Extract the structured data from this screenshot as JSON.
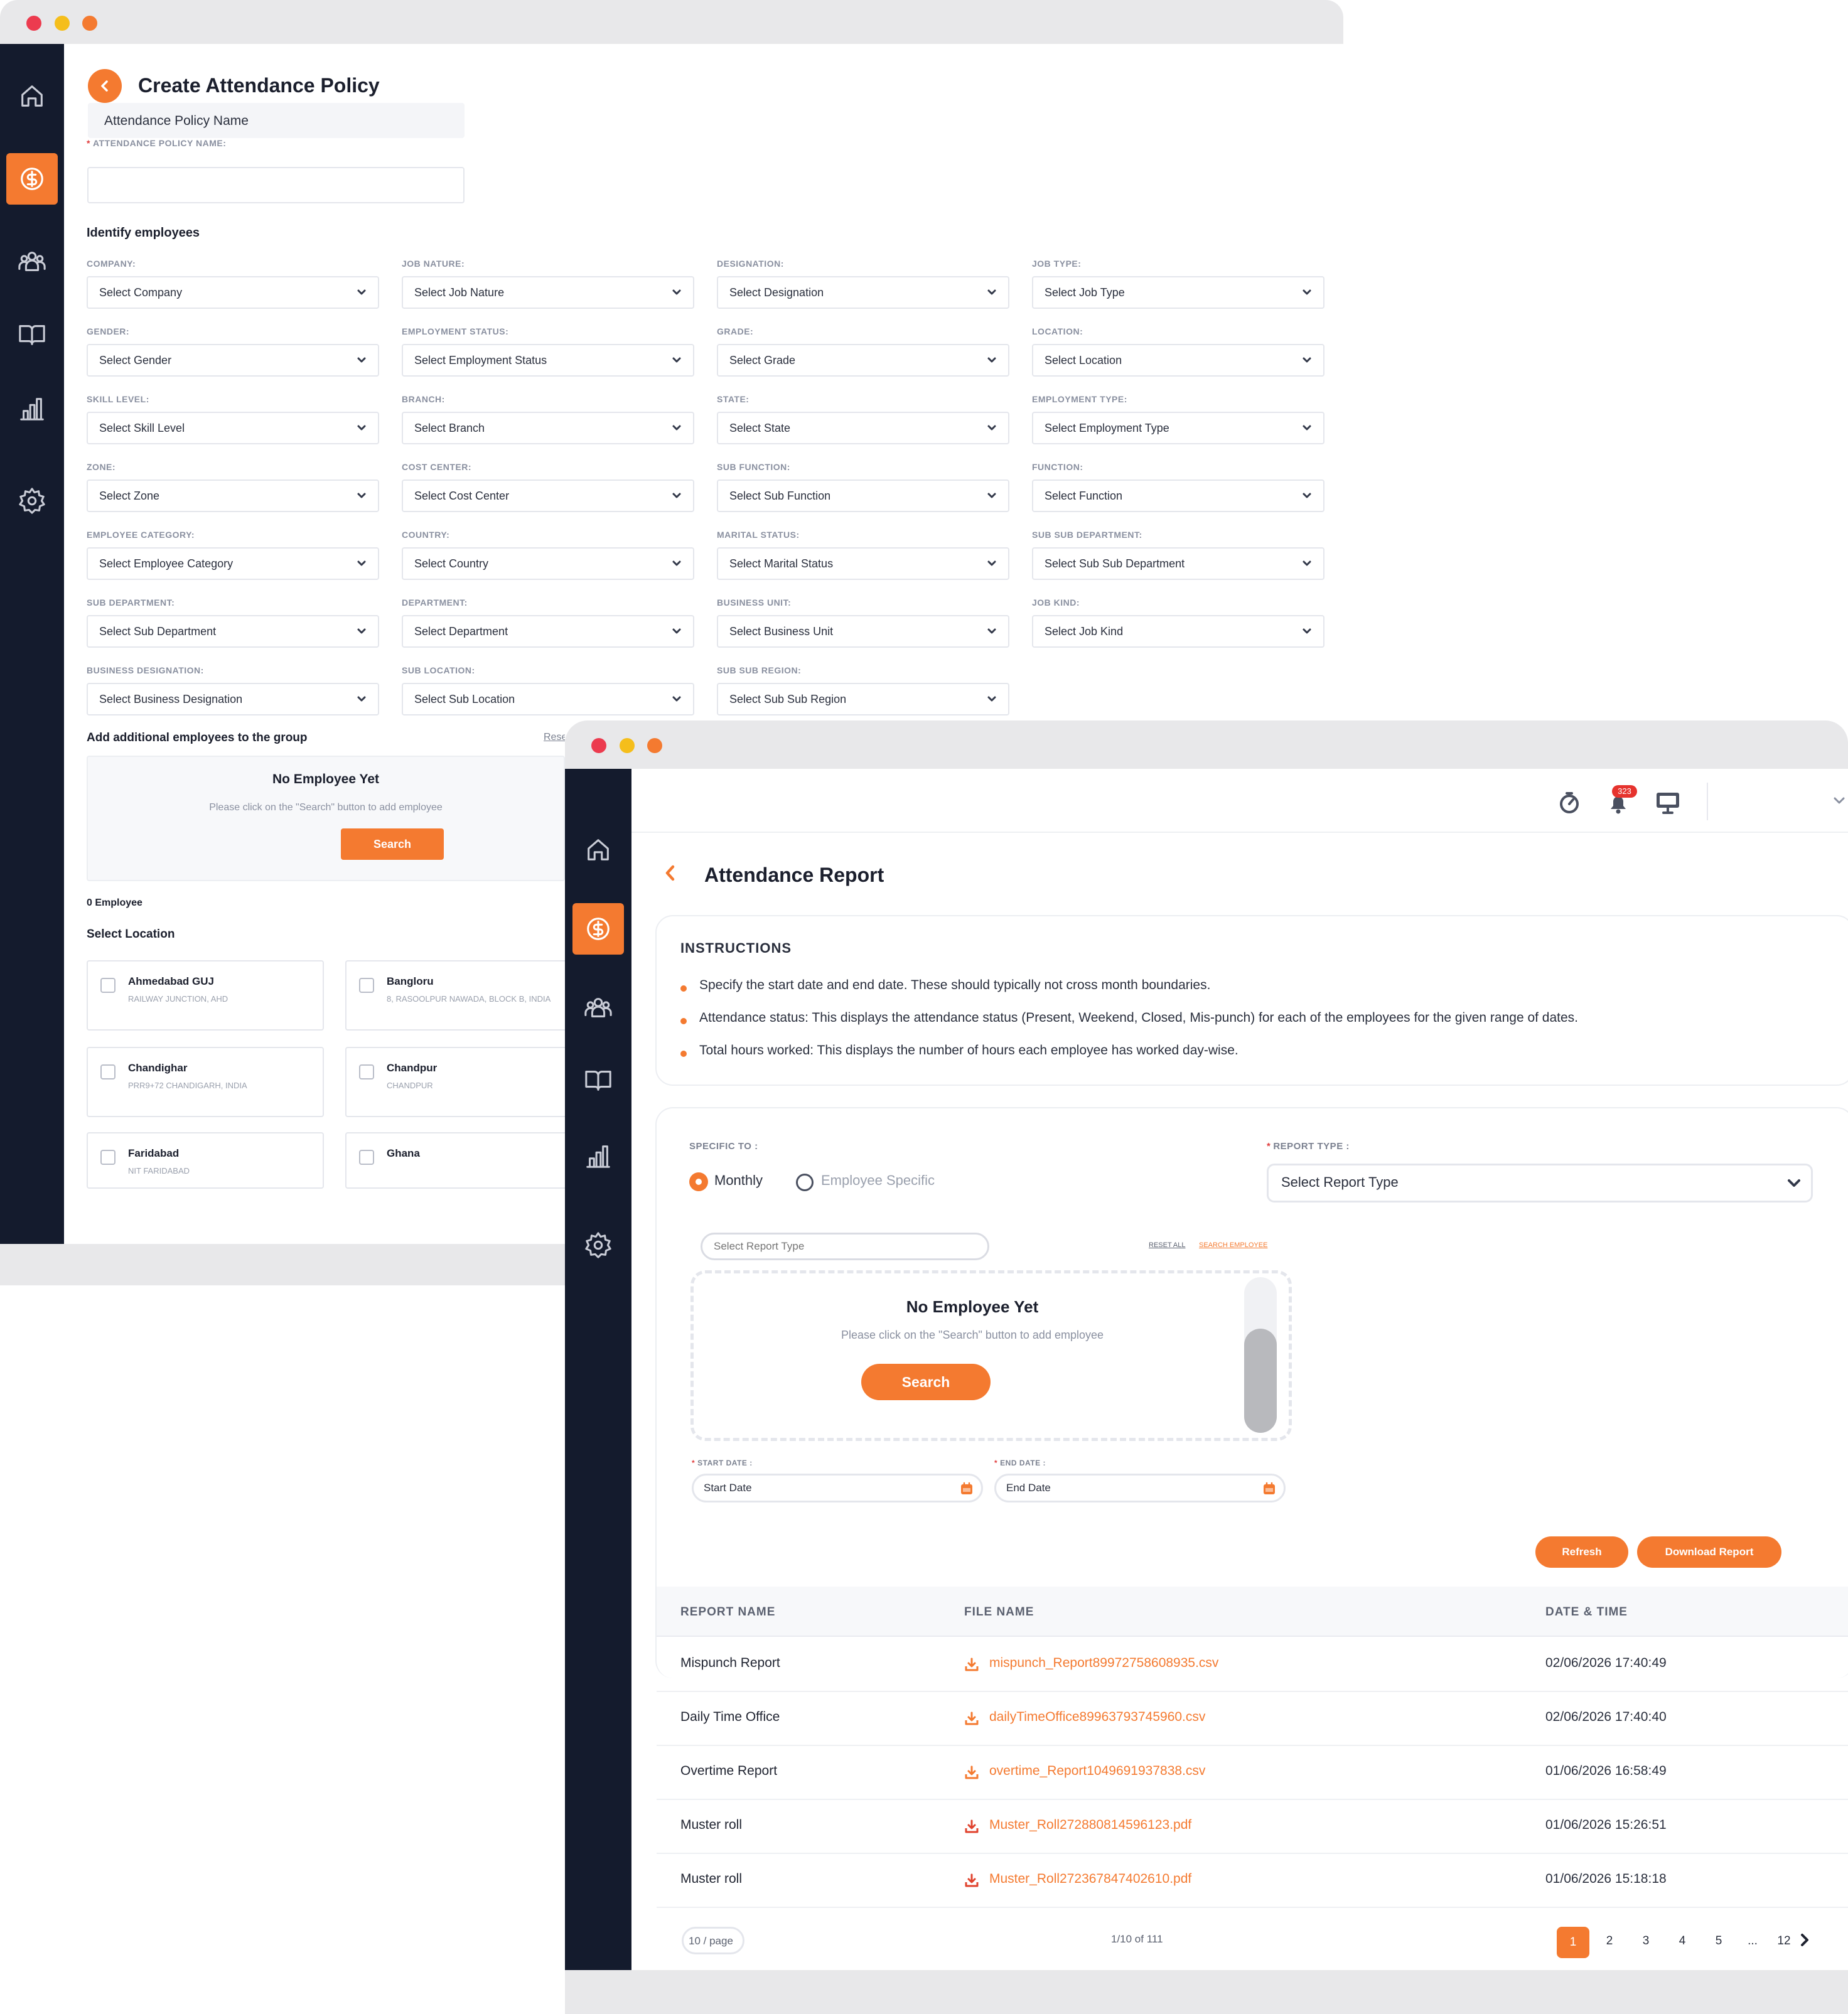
{
  "policy_window": {
    "title": "Create Attendance Policy",
    "name_tooltip": "Attendance Policy Name",
    "name_label": "ATTENDANCE POLICY NAME:",
    "name_value": "",
    "identify_heading": "Identify employees",
    "filters": [
      {
        "label": "COMPANY:",
        "placeholder": "Select Company"
      },
      {
        "label": "JOB NATURE:",
        "placeholder": "Select Job Nature"
      },
      {
        "label": "DESIGNATION:",
        "placeholder": "Select Designation"
      },
      {
        "label": "JOB TYPE:",
        "placeholder": "Select Job Type"
      },
      {
        "label": "GENDER:",
        "placeholder": "Select Gender"
      },
      {
        "label": "EMPLOYMENT STATUS:",
        "placeholder": "Select Employment Status"
      },
      {
        "label": "GRADE:",
        "placeholder": "Select Grade"
      },
      {
        "label": "LOCATION:",
        "placeholder": "Select Location"
      },
      {
        "label": "SKILL LEVEL:",
        "placeholder": "Select Skill Level"
      },
      {
        "label": "BRANCH:",
        "placeholder": "Select Branch"
      },
      {
        "label": "STATE:",
        "placeholder": "Select State"
      },
      {
        "label": "EMPLOYMENT TYPE:",
        "placeholder": "Select Employment Type"
      },
      {
        "label": "ZONE:",
        "placeholder": "Select Zone"
      },
      {
        "label": "COST CENTER:",
        "placeholder": "Select Cost Center"
      },
      {
        "label": "SUB FUNCTION:",
        "placeholder": "Select Sub Function"
      },
      {
        "label": "FUNCTION:",
        "placeholder": "Select Function"
      },
      {
        "label": "EMPLOYEE CATEGORY:",
        "placeholder": "Select Employee Category"
      },
      {
        "label": "COUNTRY:",
        "placeholder": "Select Country"
      },
      {
        "label": "MARITAL STATUS:",
        "placeholder": "Select Marital Status"
      },
      {
        "label": "SUB SUB DEPARTMENT:",
        "placeholder": "Select Sub Sub Department"
      },
      {
        "label": "SUB DEPARTMENT:",
        "placeholder": "Select Sub Department"
      },
      {
        "label": "DEPARTMENT:",
        "placeholder": "Select Department"
      },
      {
        "label": "BUSINESS UNIT:",
        "placeholder": "Select Business Unit"
      },
      {
        "label": "JOB KIND:",
        "placeholder": "Select Job Kind"
      },
      {
        "label": "BUSINESS DESIGNATION:",
        "placeholder": "Select Business Designation"
      },
      {
        "label": "SUB LOCATION:",
        "placeholder": "Select Sub Location"
      },
      {
        "label": "SUB SUB REGION:",
        "placeholder": "Select Sub Sub Region"
      }
    ],
    "additional_heading": "Add additional employees to the group",
    "reset_link": "Rese",
    "empty_title": "No Employee Yet",
    "empty_sub": "Please click on the \"Search\" button to add employee",
    "search_button": "Search",
    "employee_count": "0 Employee",
    "select_location_heading": "Select Location",
    "locations": [
      {
        "name": "Ahmedabad GUJ",
        "address": "RAILWAY JUNCTION, AHD"
      },
      {
        "name": "Bangloru",
        "address": "8, RASOOLPUR NAWADA, BLOCK B, INDIA"
      },
      {
        "name": "Chandighar",
        "address": "PRR9+72 CHANDIGARH, INDIA"
      },
      {
        "name": "Chandpur",
        "address": "CHANDPUR"
      },
      {
        "name": "Faridabad",
        "address": "NIT FARIDABAD"
      },
      {
        "name": "Ghana",
        "address": ""
      }
    ]
  },
  "report_window": {
    "notification_count": "323",
    "title": "Attendance Report",
    "instructions_heading": "INSTRUCTIONS",
    "instructions": [
      "Specify the start date and end date. These should typically not cross month boundaries.",
      "Attendance status: This displays the attendance status (Present, Weekend, Closed, Mis-punch) for each of the employees for the given range of dates.",
      "Total hours worked: This displays the number of hours each employee has worked day-wise."
    ],
    "specific_to_label": "SPECIFIC TO :",
    "radio_monthly": "Monthly",
    "radio_employee": "Employee Specific",
    "report_type_label": "REPORT TYPE :",
    "report_type_value": "Select Report Type",
    "search_input_placeholder": "Select Report Type",
    "reset_all": "RESET ALL",
    "search_employee": "SEARCH EMPLOYEE",
    "empty_title": "No Employee Yet",
    "empty_sub": "Please click on the \"Search\" button to add employee",
    "search_button": "Search",
    "start_date_label": "START DATE :",
    "start_date_placeholder": "Start Date",
    "end_date_label": "END DATE :",
    "end_date_placeholder": "End Date",
    "refresh_button": "Refresh",
    "download_button": "Download Report",
    "table": {
      "headers": [
        "REPORT NAME",
        "FILE NAME",
        "DATE & TIME"
      ],
      "rows": [
        {
          "name": "Mispunch Report",
          "file": "mispunch_Report89972758608935.csv",
          "date": "02/06/2026 17:40:49",
          "file_type": "csv"
        },
        {
          "name": "Daily Time Office",
          "file": "dailyTimeOffice89963793745960.csv",
          "date": "02/06/2026 17:40:40",
          "file_type": "csv"
        },
        {
          "name": "Overtime Report",
          "file": "overtime_Report1049691937838.csv",
          "date": "01/06/2026 16:58:49",
          "file_type": "csv"
        },
        {
          "name": "Muster roll",
          "file": "Muster_Roll272880814596123.pdf",
          "date": "01/06/2026 15:26:51",
          "file_type": "pdf"
        },
        {
          "name": "Muster roll",
          "file": "Muster_Roll272367847402610.pdf",
          "date": "01/06/2026 15:18:18",
          "file_type": "pdf"
        }
      ]
    },
    "page_size": "10 / page",
    "range_text": "1/10 of 111",
    "pages": [
      "1",
      "2",
      "3",
      "4",
      "5",
      "...",
      "12"
    ],
    "current_page": "1"
  },
  "colors": {
    "accent": "#f47a30",
    "sidebar": "#141b2d",
    "dot_red": "#ec3b4f",
    "dot_yellow": "#f5be1b",
    "dot_orange": "#f47a30",
    "pdf_icon": "#e0432e"
  },
  "icons": {
    "sidebar": [
      "home-icon",
      "dollar-icon",
      "team-icon",
      "book-icon",
      "chart-icon",
      "gear-icon"
    ],
    "header": [
      "timer-icon",
      "bell-icon",
      "monitor-icon",
      "chevron-down-icon"
    ]
  }
}
